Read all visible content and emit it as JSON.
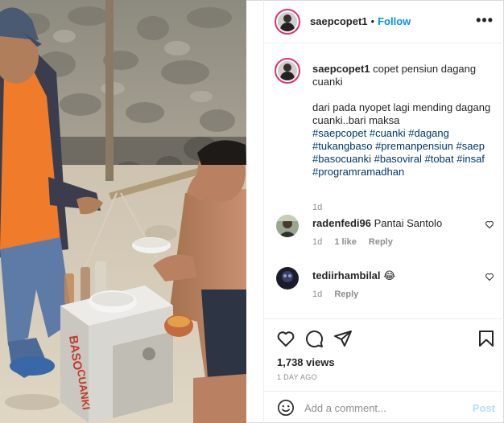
{
  "post": {
    "username": "saepcopet1",
    "separator": "•",
    "follow_label": "Follow",
    "more_label": "•••"
  },
  "caption": {
    "username": "saepcopet1",
    "title_text": "copet pensiun dagang cuanki",
    "body_text": "dari pada nyopet lagi mending dagang cuanki..bari maksa",
    "hashtags": "#saepcopet #cuanki #dagang #tukangbaso #premanpensiun #saep #basocuanki #basoviral #tobat #insaf #programramadhan",
    "time": "1d"
  },
  "comments": [
    {
      "username": "radenfedi96",
      "text": "Pantai Santolo",
      "time": "1d",
      "likes": "1 like",
      "reply_label": "Reply"
    },
    {
      "username": "tediirhambilal",
      "text": "😂",
      "time": "1d",
      "reply_label": "Reply"
    }
  ],
  "actions": {
    "icons": [
      "heart-icon",
      "comment-icon",
      "share-icon",
      "bookmark-icon"
    ],
    "views": "1,738 views",
    "posted": "1 DAY AGO"
  },
  "add_comment": {
    "placeholder": "Add a comment...",
    "post_label": "Post",
    "emoji_icon": "smiley-icon"
  },
  "media": {
    "cart_text_left": "BASO",
    "cart_text_right": "CUANKI"
  },
  "colors": {
    "accent": "#0095f6",
    "link": "#00376b",
    "muted": "#8e8e8e",
    "post_disabled": "#b2dffc",
    "story_ring": "#e1306c"
  }
}
